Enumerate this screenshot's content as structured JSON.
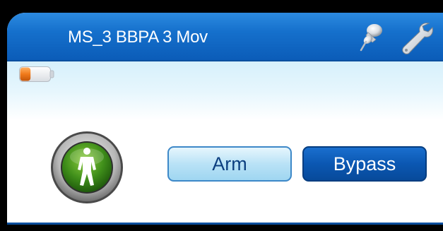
{
  "header": {
    "title": "MS_3 BBPA 3 Mov"
  },
  "icons": {
    "pin": "pin-icon",
    "settings": "wrench-icon",
    "battery": "battery-icon",
    "zone_status": "person-walking-icon"
  },
  "battery": {
    "level": 0.35
  },
  "actions": {
    "arm_label": "Arm",
    "bypass_label": "Bypass"
  },
  "colors": {
    "header_blue": "#1570cc",
    "battery_orange": "#f07a1a",
    "zone_green": "#3f8e1a",
    "bypass_blue": "#0b57b2"
  }
}
